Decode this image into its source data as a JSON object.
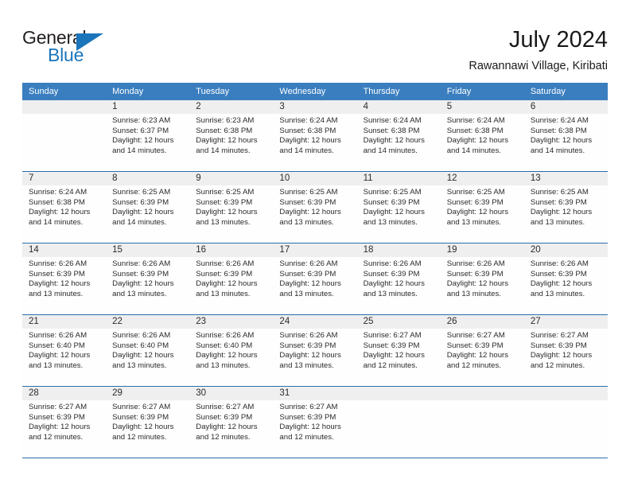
{
  "brand": {
    "name_part1": "General",
    "name_part2": "Blue",
    "logo_icon": "triangle-logo-icon",
    "accent_color": "#1b75bb"
  },
  "header": {
    "title": "July 2024",
    "subtitle": "Rawannawi Village, Kiribati"
  },
  "calendar": {
    "header_bg": "#3a7ebf",
    "row_divider_color": "#2b6cab",
    "daynum_bg": "#efefef",
    "weekdays": [
      "Sunday",
      "Monday",
      "Tuesday",
      "Wednesday",
      "Thursday",
      "Friday",
      "Saturday"
    ],
    "weeks": [
      {
        "days": [
          {
            "num": "",
            "sunrise": "",
            "sunset": "",
            "daylight_line1": "",
            "daylight_line2": "",
            "empty": true
          },
          {
            "num": "1",
            "sunrise": "Sunrise: 6:23 AM",
            "sunset": "Sunset: 6:37 PM",
            "daylight_line1": "Daylight: 12 hours",
            "daylight_line2": "and 14 minutes.",
            "empty": false
          },
          {
            "num": "2",
            "sunrise": "Sunrise: 6:23 AM",
            "sunset": "Sunset: 6:38 PM",
            "daylight_line1": "Daylight: 12 hours",
            "daylight_line2": "and 14 minutes.",
            "empty": false
          },
          {
            "num": "3",
            "sunrise": "Sunrise: 6:24 AM",
            "sunset": "Sunset: 6:38 PM",
            "daylight_line1": "Daylight: 12 hours",
            "daylight_line2": "and 14 minutes.",
            "empty": false
          },
          {
            "num": "4",
            "sunrise": "Sunrise: 6:24 AM",
            "sunset": "Sunset: 6:38 PM",
            "daylight_line1": "Daylight: 12 hours",
            "daylight_line2": "and 14 minutes.",
            "empty": false
          },
          {
            "num": "5",
            "sunrise": "Sunrise: 6:24 AM",
            "sunset": "Sunset: 6:38 PM",
            "daylight_line1": "Daylight: 12 hours",
            "daylight_line2": "and 14 minutes.",
            "empty": false
          },
          {
            "num": "6",
            "sunrise": "Sunrise: 6:24 AM",
            "sunset": "Sunset: 6:38 PM",
            "daylight_line1": "Daylight: 12 hours",
            "daylight_line2": "and 14 minutes.",
            "empty": false
          }
        ]
      },
      {
        "days": [
          {
            "num": "7",
            "sunrise": "Sunrise: 6:24 AM",
            "sunset": "Sunset: 6:38 PM",
            "daylight_line1": "Daylight: 12 hours",
            "daylight_line2": "and 14 minutes.",
            "empty": false
          },
          {
            "num": "8",
            "sunrise": "Sunrise: 6:25 AM",
            "sunset": "Sunset: 6:39 PM",
            "daylight_line1": "Daylight: 12 hours",
            "daylight_line2": "and 14 minutes.",
            "empty": false
          },
          {
            "num": "9",
            "sunrise": "Sunrise: 6:25 AM",
            "sunset": "Sunset: 6:39 PM",
            "daylight_line1": "Daylight: 12 hours",
            "daylight_line2": "and 13 minutes.",
            "empty": false
          },
          {
            "num": "10",
            "sunrise": "Sunrise: 6:25 AM",
            "sunset": "Sunset: 6:39 PM",
            "daylight_line1": "Daylight: 12 hours",
            "daylight_line2": "and 13 minutes.",
            "empty": false
          },
          {
            "num": "11",
            "sunrise": "Sunrise: 6:25 AM",
            "sunset": "Sunset: 6:39 PM",
            "daylight_line1": "Daylight: 12 hours",
            "daylight_line2": "and 13 minutes.",
            "empty": false
          },
          {
            "num": "12",
            "sunrise": "Sunrise: 6:25 AM",
            "sunset": "Sunset: 6:39 PM",
            "daylight_line1": "Daylight: 12 hours",
            "daylight_line2": "and 13 minutes.",
            "empty": false
          },
          {
            "num": "13",
            "sunrise": "Sunrise: 6:25 AM",
            "sunset": "Sunset: 6:39 PM",
            "daylight_line1": "Daylight: 12 hours",
            "daylight_line2": "and 13 minutes.",
            "empty": false
          }
        ]
      },
      {
        "days": [
          {
            "num": "14",
            "sunrise": "Sunrise: 6:26 AM",
            "sunset": "Sunset: 6:39 PM",
            "daylight_line1": "Daylight: 12 hours",
            "daylight_line2": "and 13 minutes.",
            "empty": false
          },
          {
            "num": "15",
            "sunrise": "Sunrise: 6:26 AM",
            "sunset": "Sunset: 6:39 PM",
            "daylight_line1": "Daylight: 12 hours",
            "daylight_line2": "and 13 minutes.",
            "empty": false
          },
          {
            "num": "16",
            "sunrise": "Sunrise: 6:26 AM",
            "sunset": "Sunset: 6:39 PM",
            "daylight_line1": "Daylight: 12 hours",
            "daylight_line2": "and 13 minutes.",
            "empty": false
          },
          {
            "num": "17",
            "sunrise": "Sunrise: 6:26 AM",
            "sunset": "Sunset: 6:39 PM",
            "daylight_line1": "Daylight: 12 hours",
            "daylight_line2": "and 13 minutes.",
            "empty": false
          },
          {
            "num": "18",
            "sunrise": "Sunrise: 6:26 AM",
            "sunset": "Sunset: 6:39 PM",
            "daylight_line1": "Daylight: 12 hours",
            "daylight_line2": "and 13 minutes.",
            "empty": false
          },
          {
            "num": "19",
            "sunrise": "Sunrise: 6:26 AM",
            "sunset": "Sunset: 6:39 PM",
            "daylight_line1": "Daylight: 12 hours",
            "daylight_line2": "and 13 minutes.",
            "empty": false
          },
          {
            "num": "20",
            "sunrise": "Sunrise: 6:26 AM",
            "sunset": "Sunset: 6:39 PM",
            "daylight_line1": "Daylight: 12 hours",
            "daylight_line2": "and 13 minutes.",
            "empty": false
          }
        ]
      },
      {
        "days": [
          {
            "num": "21",
            "sunrise": "Sunrise: 6:26 AM",
            "sunset": "Sunset: 6:40 PM",
            "daylight_line1": "Daylight: 12 hours",
            "daylight_line2": "and 13 minutes.",
            "empty": false
          },
          {
            "num": "22",
            "sunrise": "Sunrise: 6:26 AM",
            "sunset": "Sunset: 6:40 PM",
            "daylight_line1": "Daylight: 12 hours",
            "daylight_line2": "and 13 minutes.",
            "empty": false
          },
          {
            "num": "23",
            "sunrise": "Sunrise: 6:26 AM",
            "sunset": "Sunset: 6:40 PM",
            "daylight_line1": "Daylight: 12 hours",
            "daylight_line2": "and 13 minutes.",
            "empty": false
          },
          {
            "num": "24",
            "sunrise": "Sunrise: 6:26 AM",
            "sunset": "Sunset: 6:39 PM",
            "daylight_line1": "Daylight: 12 hours",
            "daylight_line2": "and 13 minutes.",
            "empty": false
          },
          {
            "num": "25",
            "sunrise": "Sunrise: 6:27 AM",
            "sunset": "Sunset: 6:39 PM",
            "daylight_line1": "Daylight: 12 hours",
            "daylight_line2": "and 12 minutes.",
            "empty": false
          },
          {
            "num": "26",
            "sunrise": "Sunrise: 6:27 AM",
            "sunset": "Sunset: 6:39 PM",
            "daylight_line1": "Daylight: 12 hours",
            "daylight_line2": "and 12 minutes.",
            "empty": false
          },
          {
            "num": "27",
            "sunrise": "Sunrise: 6:27 AM",
            "sunset": "Sunset: 6:39 PM",
            "daylight_line1": "Daylight: 12 hours",
            "daylight_line2": "and 12 minutes.",
            "empty": false
          }
        ]
      },
      {
        "days": [
          {
            "num": "28",
            "sunrise": "Sunrise: 6:27 AM",
            "sunset": "Sunset: 6:39 PM",
            "daylight_line1": "Daylight: 12 hours",
            "daylight_line2": "and 12 minutes.",
            "empty": false
          },
          {
            "num": "29",
            "sunrise": "Sunrise: 6:27 AM",
            "sunset": "Sunset: 6:39 PM",
            "daylight_line1": "Daylight: 12 hours",
            "daylight_line2": "and 12 minutes.",
            "empty": false
          },
          {
            "num": "30",
            "sunrise": "Sunrise: 6:27 AM",
            "sunset": "Sunset: 6:39 PM",
            "daylight_line1": "Daylight: 12 hours",
            "daylight_line2": "and 12 minutes.",
            "empty": false
          },
          {
            "num": "31",
            "sunrise": "Sunrise: 6:27 AM",
            "sunset": "Sunset: 6:39 PM",
            "daylight_line1": "Daylight: 12 hours",
            "daylight_line2": "and 12 minutes.",
            "empty": false
          },
          {
            "num": "",
            "sunrise": "",
            "sunset": "",
            "daylight_line1": "",
            "daylight_line2": "",
            "empty": true
          },
          {
            "num": "",
            "sunrise": "",
            "sunset": "",
            "daylight_line1": "",
            "daylight_line2": "",
            "empty": true
          },
          {
            "num": "",
            "sunrise": "",
            "sunset": "",
            "daylight_line1": "",
            "daylight_line2": "",
            "empty": true
          }
        ]
      }
    ]
  }
}
